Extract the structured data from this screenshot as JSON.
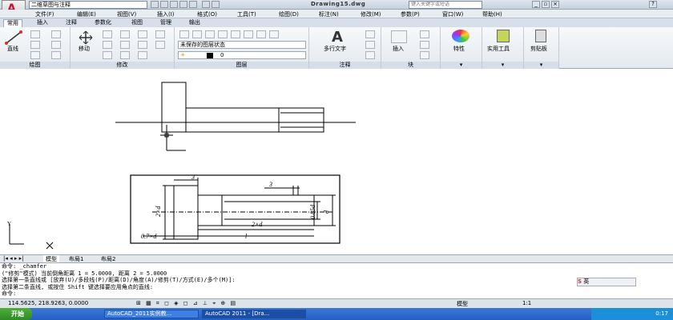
{
  "titlebar": {
    "workspace": "二维草图与注释",
    "document": "Drawing15.dwg",
    "search_placeholder": "键入关键字或短语"
  },
  "menus": [
    "文件(F)",
    "编辑(E)",
    "视图(V)",
    "插入(I)",
    "格式(O)",
    "工具(T)",
    "绘图(D)",
    "标注(N)",
    "修改(M)",
    "参数(P)",
    "窗口(W)",
    "帮助(H)"
  ],
  "tabs": [
    "常用",
    "插入",
    "注释",
    "参数化",
    "视图",
    "管理",
    "输出"
  ],
  "ribbon": {
    "line": "直线",
    "move": "移动",
    "layer_state": "未保存的图层状态",
    "layer_name": "0",
    "text": "多行文字",
    "insert": "插入",
    "properties": "特性",
    "utilities": "实用工具",
    "clipboard": "剪贴板",
    "panels": [
      "绘图",
      "修改",
      "图层",
      "注释",
      "块"
    ]
  },
  "drawing": {
    "dims": [
      "3",
      "3",
      "2×d",
      "0.85d",
      "d",
      "2×d",
      "0.7×d",
      "l"
    ]
  },
  "layout_tabs": [
    "模型",
    "布局1",
    "布局2"
  ],
  "command_lines": [
    "命令:  _chamfer",
    "(\"修剪\"模式) 当前倒角距离 1 = 5.0000, 距离 2 = 5.0000",
    "选择第一条直线或 [放弃(U)/多段线(P)/距离(D)/角度(A)/修剪(T)/方式(E)/多个(M)]:",
    "选择第二条直线, 或按住 Shift 键选择要应用角点的直线:",
    "命令:"
  ],
  "status": {
    "coords": "114.5625, 218.9263, 0.0000",
    "space": "模型",
    "scale": "1:1"
  },
  "ime": "英",
  "taskbar": {
    "start": "开始",
    "items": [
      "AutoCAD_2011实例教...",
      "AutoCAD 2011 - [Dra..."
    ],
    "time": "0:17"
  }
}
